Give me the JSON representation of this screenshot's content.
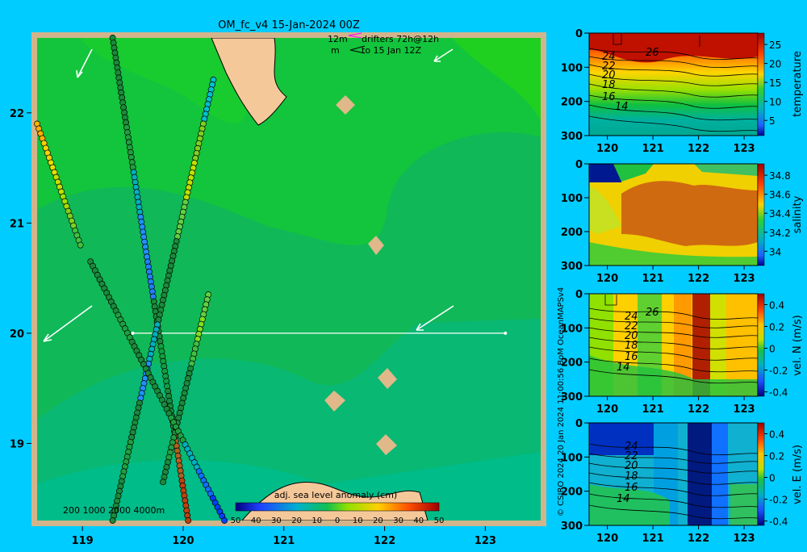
{
  "title": "OM_fc_v4  15-Jan-2024 00Z",
  "drifter_legend": {
    "line1_prefix": "12m",
    "line1_rest": "drifters 72h@12h",
    "line2_prefix": "m",
    "line2_rest": "to 15 Jan 12Z"
  },
  "depth_legend": "200  1000  2000  4000m",
  "credit": "© CSIRO 2024  20 Jan 2024 11:00:56 BoM OceanMAPSv4",
  "colors": {
    "background": "#00ccff",
    "land": "#f5c89a",
    "frame": "#d2b48c"
  },
  "chart_data": [
    {
      "type": "heatmap",
      "name": "map",
      "x_ticks": [
        "119",
        "120",
        "121",
        "122",
        "123"
      ],
      "y_ticks": [
        "22",
        "21",
        "20",
        "19"
      ],
      "xlim": [
        118.55,
        123.55
      ],
      "ylim": [
        18.3,
        22.68
      ],
      "colorbar": {
        "label": "adj. sea level anomaly (cm)",
        "ticks": [
          "-50",
          "-40",
          "-30",
          "-20",
          "-10",
          "0",
          "10",
          "20",
          "30",
          "40",
          "50"
        ],
        "range": [
          -50,
          50
        ]
      },
      "section_line": {
        "lat": 20.0,
        "lon_start": 119.5,
        "lon_end": 123.2
      },
      "altimeter_tracks": [
        {
          "lon_start": 119.3,
          "lat_start": 22.68,
          "lon_end": 120.05,
          "lat_end": 18.3
        },
        {
          "lon_start": 120.3,
          "lat_start": 22.3,
          "lon_end": 119.3,
          "lat_end": 18.3
        },
        {
          "lon_start": 120.25,
          "lat_start": 20.35,
          "lon_end": 119.8,
          "lat_end": 18.65
        },
        {
          "lon_start": 118.55,
          "lat_start": 21.9,
          "lon_end": 118.98,
          "lat_end": 20.8
        },
        {
          "lon_start": 119.08,
          "lat_start": 20.65,
          "lon_end": 120.41,
          "lat_end": 18.3
        }
      ]
    },
    {
      "type": "heatmap",
      "name": "temperature",
      "ylabel": "temperature",
      "y_ticks": [
        "0",
        "100",
        "200",
        "300"
      ],
      "x_ticks": [
        "120",
        "121",
        "122",
        "123"
      ],
      "colorbar_ticks": [
        "25",
        "20",
        "15",
        "10",
        "5"
      ],
      "contour_labels": [
        "26",
        "24",
        "22",
        "20",
        "18",
        "16",
        "14"
      ]
    },
    {
      "type": "heatmap",
      "name": "salinity",
      "ylabel": "salinity",
      "y_ticks": [
        "0",
        "100",
        "200",
        "300"
      ],
      "x_ticks": [
        "120",
        "121",
        "122",
        "123"
      ],
      "colorbar_ticks": [
        "34.8",
        "34.6",
        "34.4",
        "34.2",
        "34"
      ]
    },
    {
      "type": "heatmap",
      "name": "vel_N",
      "ylabel": "vel. N (m/s)",
      "y_ticks": [
        "0",
        "100",
        "200",
        "300"
      ],
      "x_ticks": [
        "120",
        "121",
        "122",
        "123"
      ],
      "colorbar_ticks": [
        "0.4",
        "0.2",
        "0",
        "-0.2",
        "-0.4"
      ],
      "contour_labels": [
        "26",
        "24",
        "22",
        "20",
        "18",
        "16",
        "14"
      ]
    },
    {
      "type": "heatmap",
      "name": "vel_E",
      "ylabel": "vel. E (m/s)",
      "y_ticks": [
        "0",
        "100",
        "200",
        "300"
      ],
      "x_ticks": [
        "120",
        "121",
        "122",
        "123"
      ],
      "colorbar_ticks": [
        "0.4",
        "0.2",
        "0",
        "-0.2",
        "-0.4"
      ],
      "contour_labels": [
        "24",
        "22",
        "20",
        "18",
        "16",
        "14"
      ]
    }
  ]
}
